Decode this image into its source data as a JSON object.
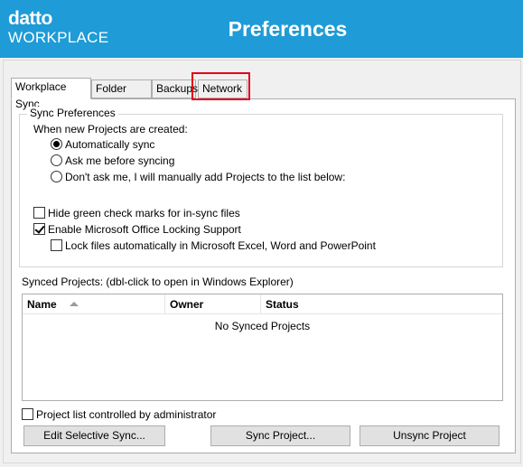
{
  "header": {
    "logo_top": "datto",
    "logo_bottom": "WORKPLACE",
    "title": "Preferences"
  },
  "tabs": [
    {
      "label": "Workplace Sync"
    },
    {
      "label": "Folder Sync"
    },
    {
      "label": "Backups"
    },
    {
      "label": "Network"
    }
  ],
  "sync_prefs": {
    "group_label": "Sync Preferences",
    "prompt": "When new Projects are created:",
    "options": [
      {
        "label": "Automatically sync",
        "selected": true
      },
      {
        "label": "Ask me before syncing",
        "selected": false
      },
      {
        "label": "Don't ask me, I will manually add Projects to the list below:",
        "selected": false
      }
    ],
    "hide_checkmarks": {
      "label": "Hide green check marks for in-sync files",
      "checked": false
    },
    "office_locking": {
      "label": "Enable Microsoft Office Locking Support",
      "checked": true
    },
    "lock_files": {
      "label": "Lock files automatically in Microsoft Excel, Word and PowerPoint",
      "checked": false
    }
  },
  "synced_projects": {
    "label": "Synced Projects: (dbl-click to open in Windows Explorer)",
    "columns": [
      "Name",
      "Owner",
      "Status"
    ],
    "empty_message": "No Synced Projects"
  },
  "admin_control": {
    "label": "Project list controlled by administrator",
    "checked": false
  },
  "buttons": {
    "edit_selective": "Edit Selective Sync...",
    "sync_project": "Sync Project...",
    "unsync_project": "Unsync Project"
  },
  "colors": {
    "header_bg": "#1f9bd7",
    "highlight": "#e0001a"
  }
}
